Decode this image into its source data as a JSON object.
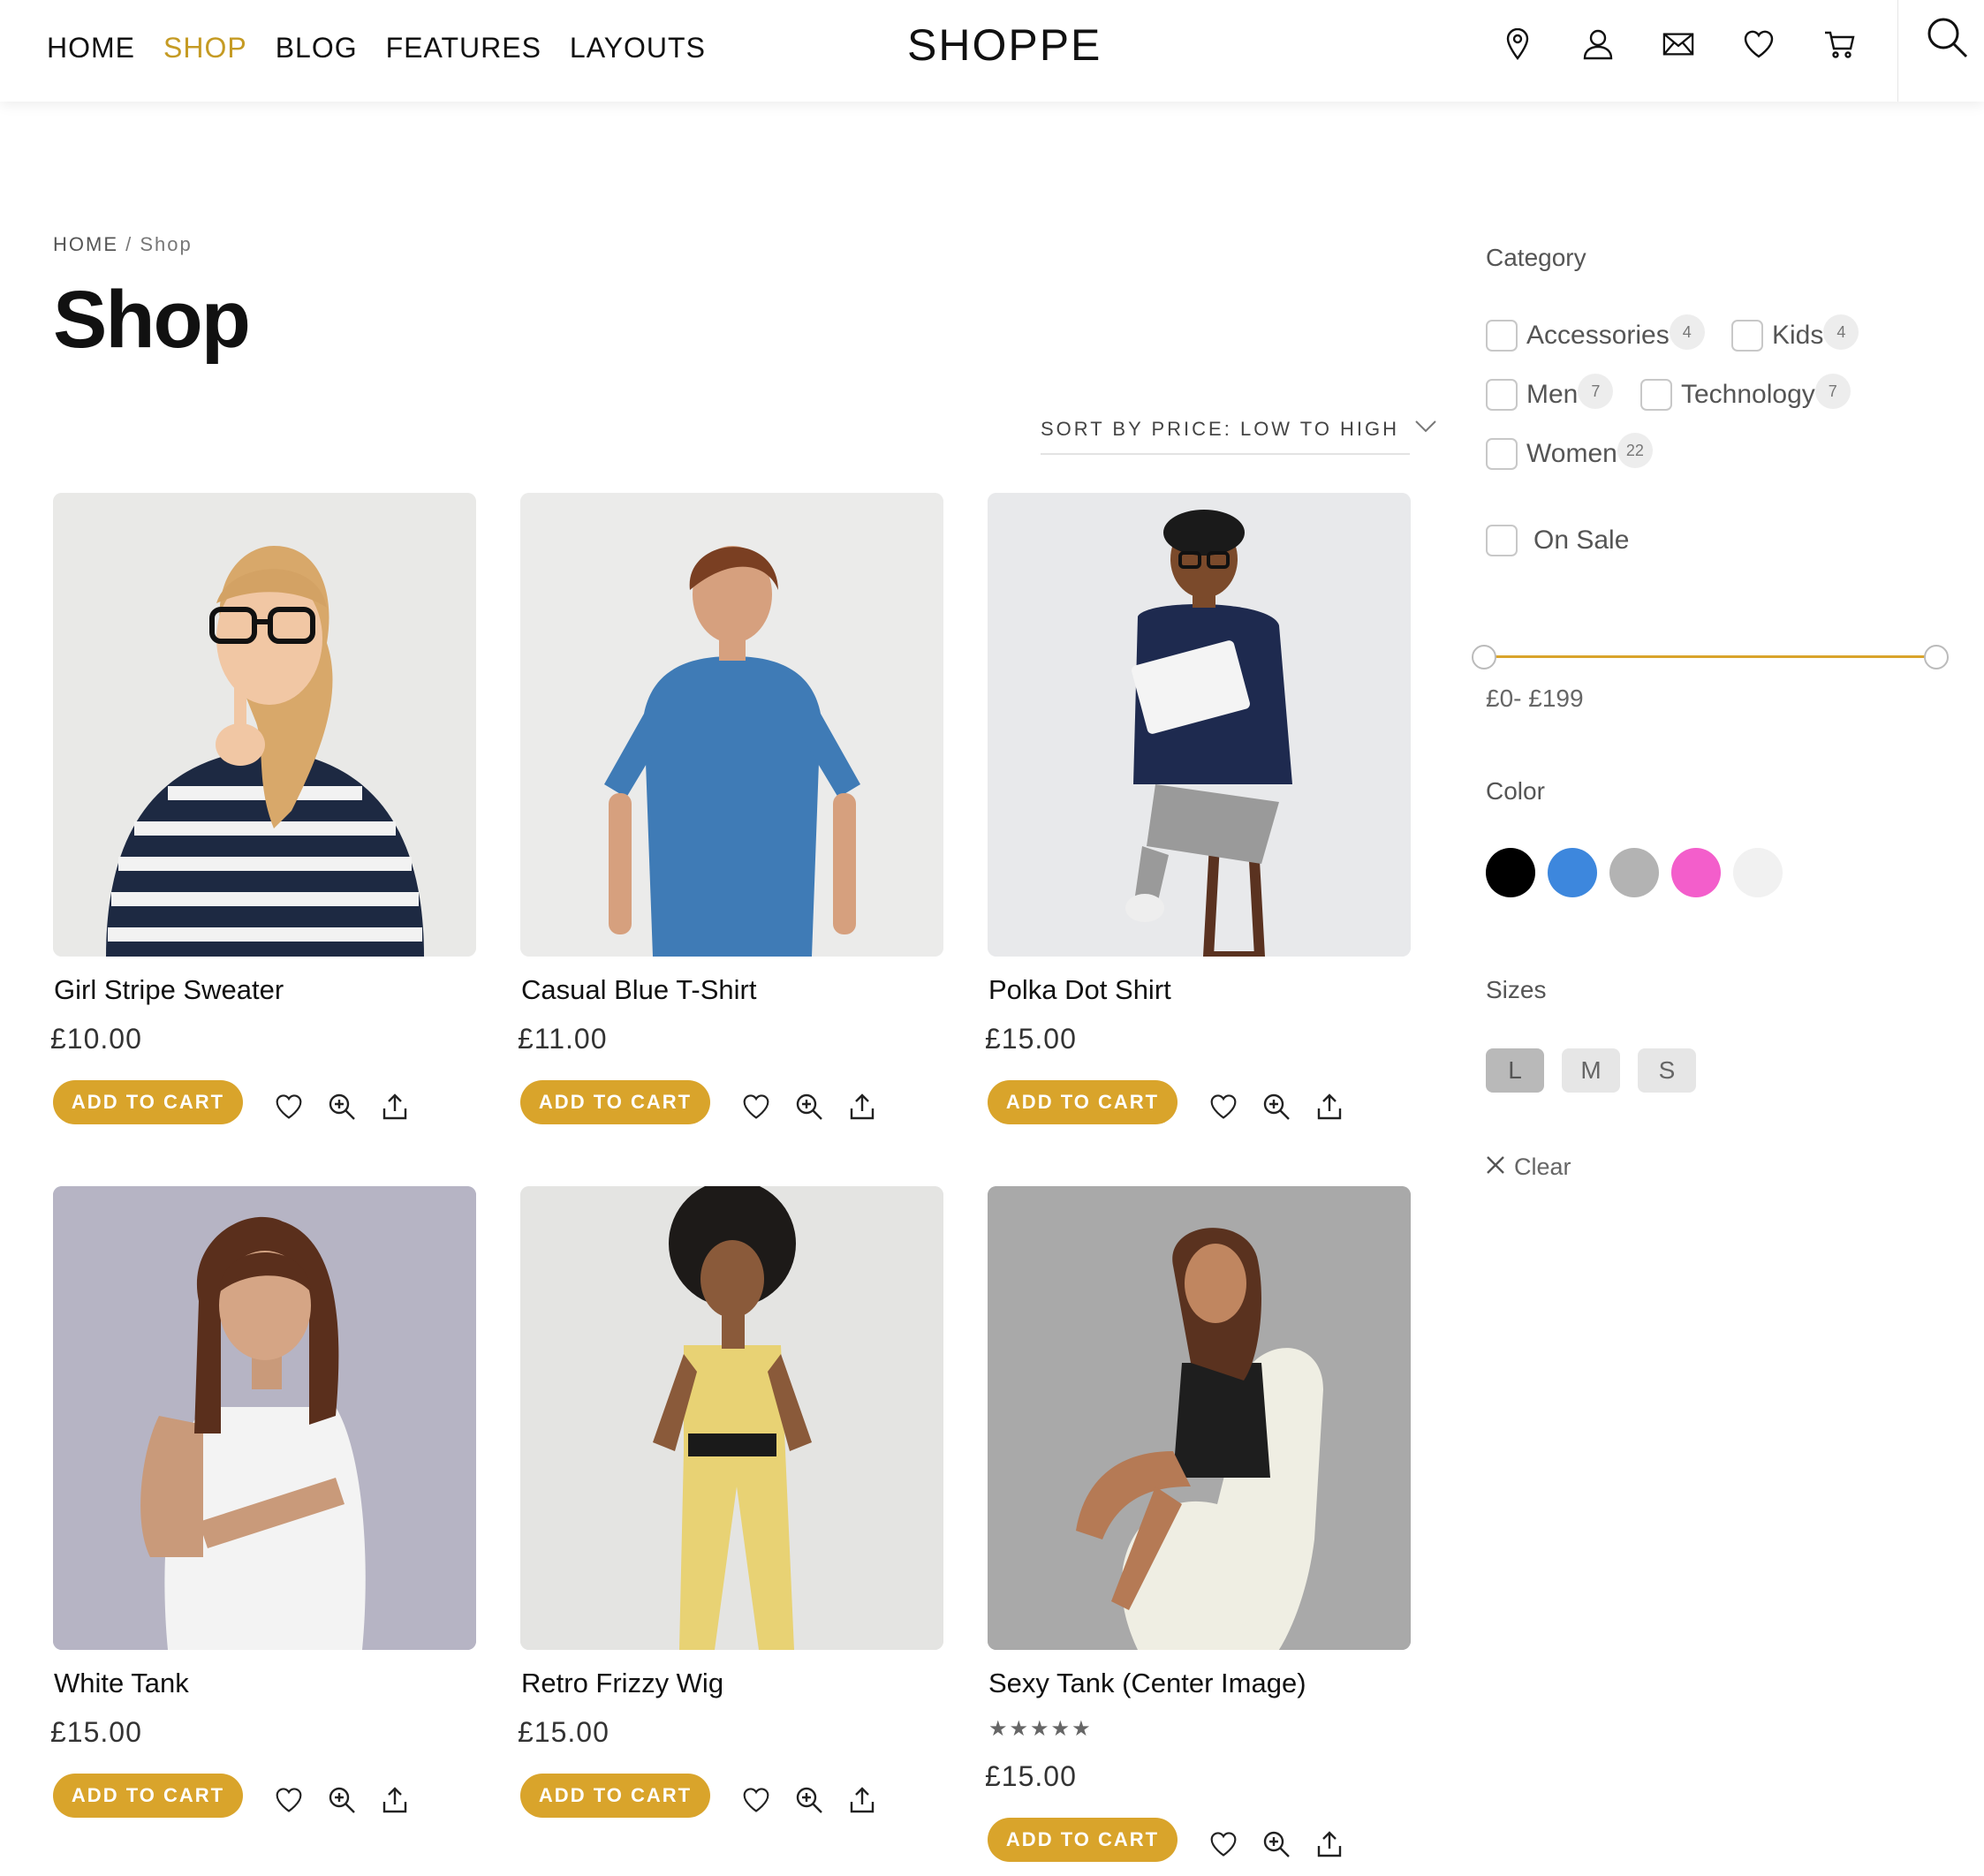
{
  "header": {
    "nav": [
      "HOME",
      "SHOP",
      "BLOG",
      "FEATURES",
      "LAYOUTS"
    ],
    "active_nav": "SHOP",
    "brand": "SHOPPE",
    "icons": [
      "location-pin-icon",
      "user-icon",
      "mail-icon",
      "heart-icon",
      "cart-icon",
      "search-icon"
    ]
  },
  "breadcrumb": {
    "home": "HOME",
    "separator": " / ",
    "current": "Shop"
  },
  "page_title": "Shop",
  "sort": {
    "label": "SORT BY PRICE: LOW TO HIGH"
  },
  "products": [
    {
      "name": "Girl Stripe Sweater",
      "price": "£10.00",
      "button": "ADD TO CART"
    },
    {
      "name": "Casual Blue T-Shirt",
      "price": "£11.00",
      "button": "ADD TO CART"
    },
    {
      "name": "Polka Dot Shirt",
      "price": "£15.00",
      "button": "ADD TO CART"
    },
    {
      "name": "White Tank",
      "price": "£15.00",
      "button": "ADD TO CART"
    },
    {
      "name": "Retro Frizzy Wig",
      "price": "£15.00",
      "button": "ADD TO CART"
    },
    {
      "name": "Sexy Tank (Center Image)",
      "price": "£15.00",
      "rating": "★★★★★",
      "rating_value": 5,
      "button": "ADD TO CART"
    }
  ],
  "product_action_icons": [
    "heart-icon",
    "zoom-in-icon",
    "share-icon"
  ],
  "sidebar": {
    "category_title": "Category",
    "categories": [
      {
        "label": "Accessories",
        "count": "4"
      },
      {
        "label": "Kids",
        "count": "4"
      },
      {
        "label": "Men",
        "count": "7"
      },
      {
        "label": "Technology",
        "count": "7"
      },
      {
        "label": "Women",
        "count": "22"
      }
    ],
    "on_sale": "On Sale",
    "price_range": {
      "label": "£0- £199",
      "min": 0,
      "max": 199
    },
    "color_title": "Color",
    "colors": [
      "#000000",
      "#3d87dd",
      "#b3b3b3",
      "#f35ecb",
      "#f1f1f1"
    ],
    "sizes_title": "Sizes",
    "sizes": [
      "L",
      "M",
      "S"
    ],
    "selected_size": "L",
    "clear": "Clear"
  },
  "theme": {
    "accent": "#d9a42b",
    "nav_active": "#c59b24"
  }
}
